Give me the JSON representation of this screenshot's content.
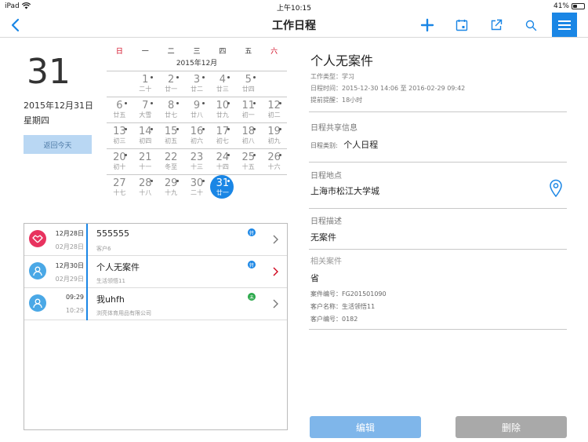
{
  "status_bar": {
    "device": "iPad",
    "time": "上午10:15",
    "battery": "41%",
    "battery_level": 0.41
  },
  "nav": {
    "title": "工作日程"
  },
  "left": {
    "big_day": "31",
    "full_date": "2015年12月31日",
    "weekday": "星期四",
    "today_button": "返回今天"
  },
  "calendar": {
    "weekdays": [
      "日",
      "一",
      "二",
      "三",
      "四",
      "五",
      "六"
    ],
    "month": "2015年12月",
    "weeks": [
      [
        null,
        {
          "d": "1",
          "l": "二十",
          "dot": true
        },
        {
          "d": "2",
          "l": "廿一",
          "dot": true
        },
        {
          "d": "3",
          "l": "廿二",
          "dot": true
        },
        {
          "d": "4",
          "l": "廿三",
          "dot": true
        },
        {
          "d": "5",
          "l": "廿四",
          "dot": true
        }
      ],
      [
        {
          "d": "6",
          "l": "廿五",
          "dot": true
        },
        {
          "d": "7",
          "l": "大雪",
          "dot": true
        },
        {
          "d": "8",
          "l": "廿七",
          "dot": true
        },
        {
          "d": "9",
          "l": "廿八",
          "dot": true
        },
        {
          "d": "10",
          "l": "廿九",
          "dot": true
        },
        {
          "d": "11",
          "l": "初一",
          "dot": true
        },
        {
          "d": "12",
          "l": "初二",
          "dot": true
        }
      ],
      [
        {
          "d": "13",
          "l": "初三",
          "dot": true
        },
        {
          "d": "14",
          "l": "初四",
          "dot": true
        },
        {
          "d": "15",
          "l": "初五",
          "dot": true
        },
        {
          "d": "16",
          "l": "初六",
          "dot": true
        },
        {
          "d": "17",
          "l": "初七",
          "dot": true
        },
        {
          "d": "18",
          "l": "初八",
          "dot": true
        },
        {
          "d": "19",
          "l": "初九",
          "dot": true
        }
      ],
      [
        {
          "d": "20",
          "l": "初十",
          "dot": true
        },
        {
          "d": "21",
          "l": "十一",
          "dot": false
        },
        {
          "d": "22",
          "l": "冬至",
          "dot": false
        },
        {
          "d": "23",
          "l": "十三",
          "dot": false
        },
        {
          "d": "24",
          "l": "十四",
          "dot": true
        },
        {
          "d": "25",
          "l": "十五",
          "dot": true
        },
        {
          "d": "26",
          "l": "十六",
          "dot": true
        }
      ],
      [
        {
          "d": "27",
          "l": "十七",
          "dot": false
        },
        {
          "d": "28",
          "l": "十八",
          "dot": true
        },
        {
          "d": "29",
          "l": "十九",
          "dot": true
        },
        {
          "d": "30",
          "l": "二十",
          "dot": true
        },
        {
          "d": "31",
          "l": "廿一",
          "dot": true,
          "selected": true
        },
        null,
        null
      ]
    ]
  },
  "list": [
    {
      "date1": "12月28日",
      "date2": "02月28日",
      "title": "555555",
      "subtitle": "客户6",
      "badge": "转",
      "badge_color": "#1a86e5",
      "avatar": "handshake",
      "avatar_color": "#e8335f",
      "chevron_color": "#777"
    },
    {
      "date1": "12月30日",
      "date2": "02月29日",
      "title": "个人无案件",
      "subtitle": "生活领悟11",
      "badge": "转",
      "badge_color": "#1a86e5",
      "avatar": "person",
      "avatar_color": "#4aa8e6",
      "chevron_color": "#d0021b"
    },
    {
      "date1": "09:29",
      "date2": "10:29",
      "title": "我uhfh",
      "subtitle": "浏亮体育用品有限公司",
      "badge": "未",
      "badge_color": "#2aa84a",
      "avatar": "person",
      "avatar_color": "#4aa8e6",
      "chevron_color": "#777"
    }
  ],
  "detail": {
    "title": "个人无案件",
    "work_type": "工作类型：学习",
    "schedule_time": "日程时间：2015-12-30 14:06 至 2016-02-29 09:42",
    "reminder": "提前提醒：18小时",
    "share_section": "日程共享信息",
    "category_label": "日程类别:",
    "category_value": "个人日程",
    "location_section": "日程地点",
    "location_value": "上海市松江大学城",
    "desc_section": "日程描述",
    "desc_value": "无案件",
    "case_section": "相关案件",
    "case_value": "省",
    "case_no": "案件编号：FG201501090",
    "client_name": "客户名称：生活领悟11",
    "client_no": "客户编号：0182"
  },
  "buttons": {
    "edit": "编辑",
    "delete": "删除"
  },
  "colors": {
    "accent": "#1a86e5",
    "holiday_red": "#d0021b"
  }
}
